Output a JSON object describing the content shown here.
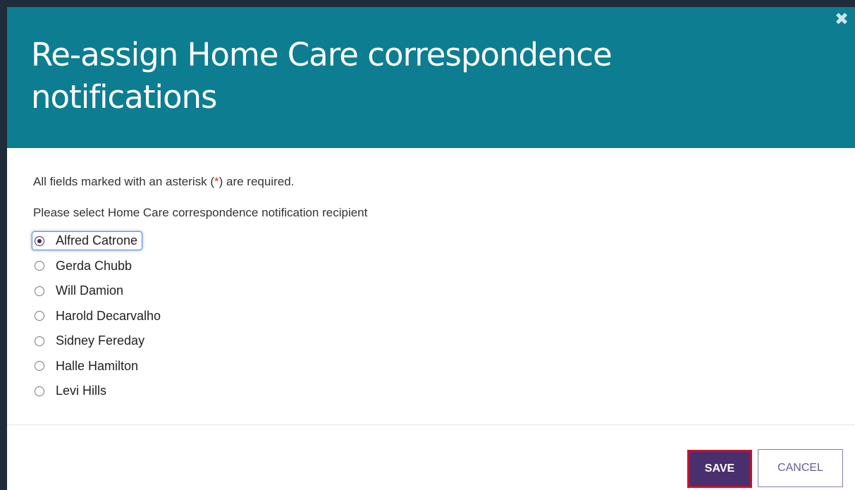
{
  "dialog": {
    "title": "Re-assign Home Care correspondence notifications",
    "close_symbol": "✖",
    "close_icon": "close-icon"
  },
  "body": {
    "required_note_prefix": "All fields marked with an asterisk (",
    "required_note_star": "*",
    "required_note_suffix": ") are required.",
    "select_label": "Please select Home Care correspondence notification recipient",
    "selected_recipient": "Alfred Catrone",
    "recipients": [
      {
        "label": "Alfred Catrone"
      },
      {
        "label": "Gerda Chubb"
      },
      {
        "label": "Will Damion"
      },
      {
        "label": "Harold Decarvalho"
      },
      {
        "label": "Sidney Fereday"
      },
      {
        "label": "Halle Hamilton"
      },
      {
        "label": "Levi Hills"
      }
    ]
  },
  "footer": {
    "save_label": "SAVE",
    "cancel_label": "CANCEL"
  },
  "colors": {
    "header_background": "#0d7d91",
    "save_background": "#4a2f6e",
    "save_highlight_border": "#c4132c",
    "cancel_border": "#8a78b1",
    "required_star": "#d9292f"
  }
}
